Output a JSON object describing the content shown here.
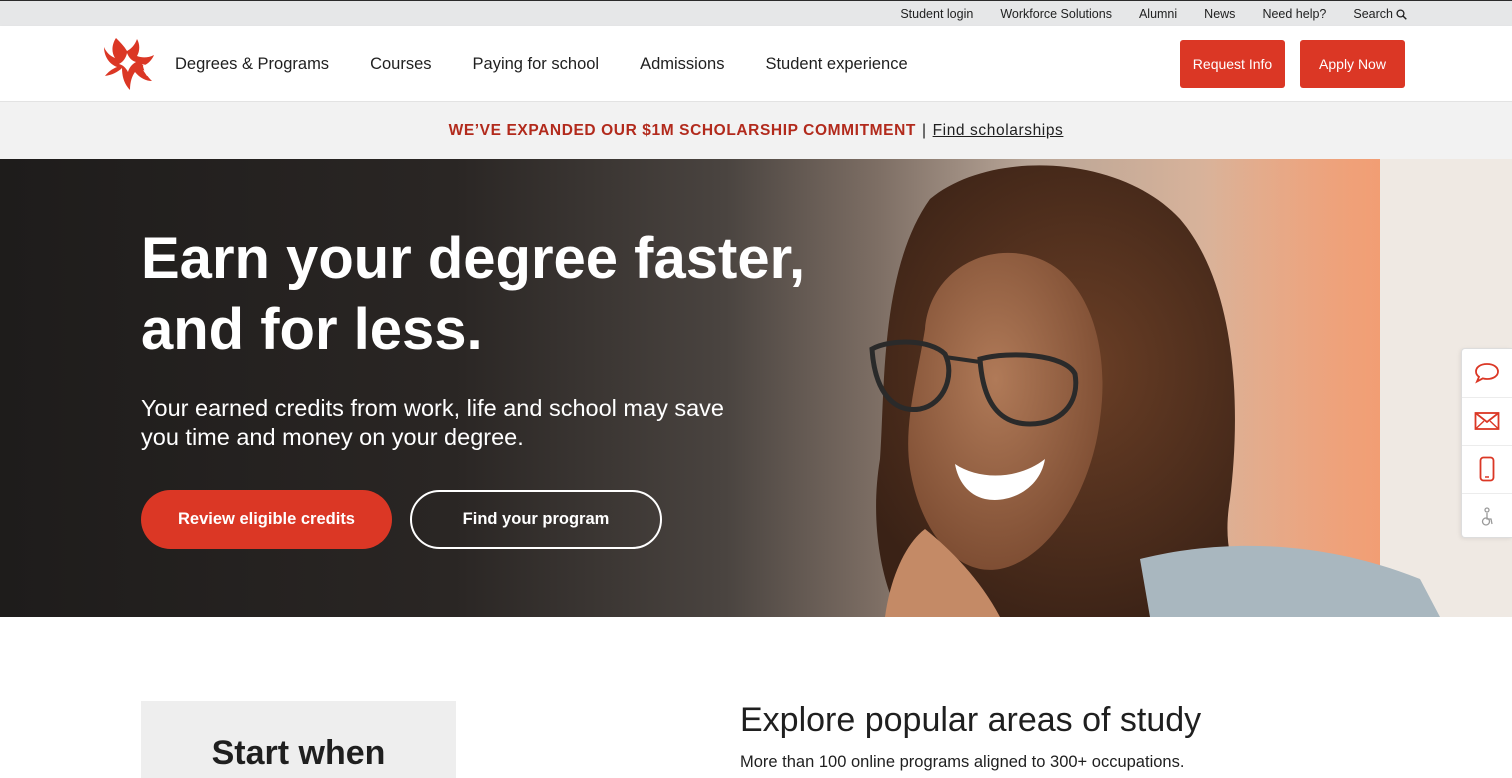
{
  "utility": {
    "links": [
      {
        "label": "Student login"
      },
      {
        "label": "Workforce Solutions"
      },
      {
        "label": "Alumni"
      },
      {
        "label": "News"
      },
      {
        "label": "Need help?"
      },
      {
        "label": "Search",
        "icon": "search-icon"
      }
    ]
  },
  "nav": {
    "items": [
      {
        "label": "Degrees & Programs"
      },
      {
        "label": "Courses"
      },
      {
        "label": "Paying for school"
      },
      {
        "label": "Admissions"
      },
      {
        "label": "Student experience"
      }
    ],
    "request_info": "Request Info",
    "apply_now": "Apply Now",
    "logo_icon": "phoenix-logo-icon"
  },
  "banner": {
    "highlight": "WE’VE EXPANDED OUR $1M SCHOLARSHIP COMMITMENT",
    "separator": "|",
    "link": "Find scholarships"
  },
  "hero": {
    "title_line1": "Earn your degree faster,",
    "title_line2": "and for less.",
    "subtitle_line1": "Your earned credits from work, life and school may save",
    "subtitle_line2": "you time and money on your degree.",
    "primary_button": "Review eligible credits",
    "secondary_button": "Find your program"
  },
  "side_rail": {
    "icons": [
      "chat-icon",
      "email-icon",
      "phone-icon",
      "accessibility-icon"
    ]
  },
  "start_card": {
    "title": "Start when"
  },
  "explore": {
    "title": "Explore popular areas of study",
    "subtitle": "More than 100 online programs aligned to 300+ occupations."
  },
  "colors": {
    "brand_red": "#db3725",
    "banner_red": "#b22a1c",
    "utility_bg": "#e6e7e8"
  }
}
